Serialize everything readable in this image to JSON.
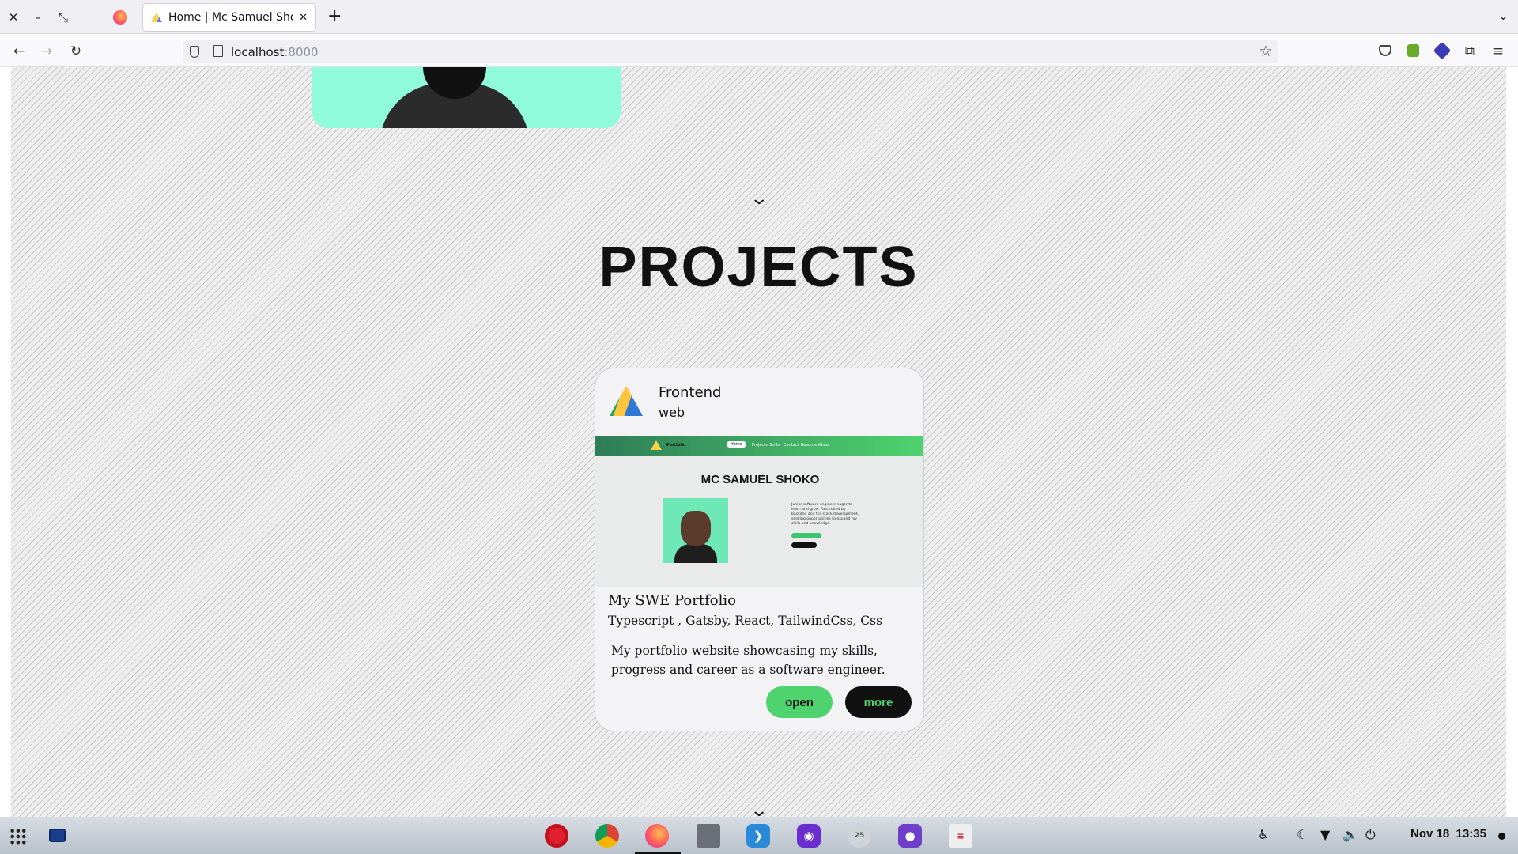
{
  "browser": {
    "tab_title": "Home | Mc Samuel Shoko",
    "new_tab": "+",
    "url_host": "localhost",
    "url_port": ":8000"
  },
  "page": {
    "section_title": "PROJECTS",
    "project": {
      "category": "Frontend",
      "type": "web",
      "screenshot": {
        "nav": [
          "Home",
          "Projects",
          "Skills",
          "Contact",
          "Resume",
          "About"
        ],
        "brand": "Portfolio",
        "heading": "MC SAMUEL SHOKO",
        "bio": "Junior software engineer eager to learn and grow. Fascinated by backend and full stack development, seeking opportunities to expand my skills and knowledge."
      },
      "name": "My SWE Portfolio",
      "stack": "Typescript , Gatsby, React, TailwindCss, Css",
      "description": "My portfolio website showcasing my skills, progress and career as a software engineer.",
      "open_label": "open",
      "more_label": "more"
    }
  },
  "taskbar": {
    "date": "Nov 18",
    "time": "13:35",
    "apps": [
      "Opera",
      "Chrome",
      "Firefox",
      "Files",
      "VS Code",
      "Tor Browser",
      "Calendar",
      "GitHub Desktop",
      "Text Editor"
    ]
  },
  "colors": {
    "accent": "#4fd36f",
    "avatar_bg": "#90fbd8",
    "dark": "#111111"
  }
}
